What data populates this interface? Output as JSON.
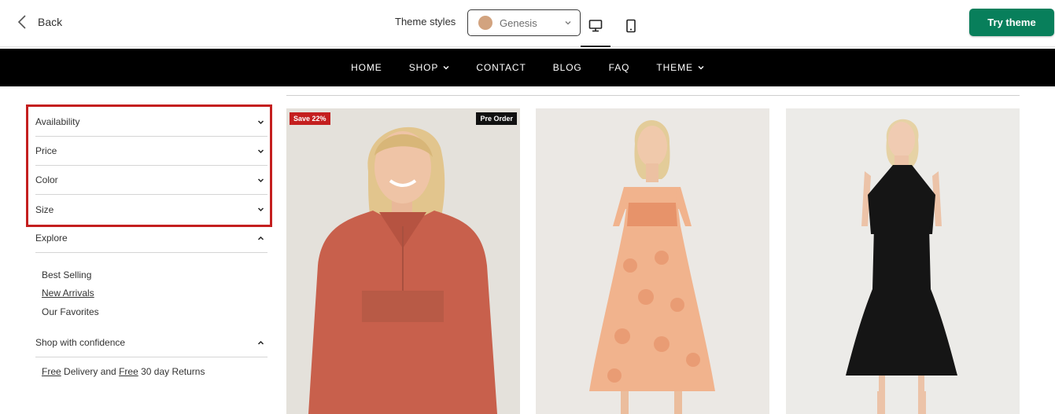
{
  "topbar": {
    "back_label": "Back",
    "theme_styles_label": "Theme styles",
    "theme_select_value": "Genesis",
    "theme_swatch_color": "#d2a37f",
    "try_theme_label": "Try theme",
    "try_theme_color": "#087f5b"
  },
  "nav": {
    "items": [
      {
        "label": "HOME",
        "dropdown": false
      },
      {
        "label": "SHOP",
        "dropdown": true
      },
      {
        "label": "CONTACT",
        "dropdown": false
      },
      {
        "label": "BLOG",
        "dropdown": false
      },
      {
        "label": "FAQ",
        "dropdown": false
      },
      {
        "label": "THEME",
        "dropdown": true
      }
    ]
  },
  "filters": {
    "highlight_color": "#c41f1f",
    "groups": [
      {
        "label": "Availability",
        "icon": "chevron-down-icon"
      },
      {
        "label": "Price",
        "icon": "chevron-down-icon"
      },
      {
        "label": "Color",
        "icon": "chevron-down-icon"
      },
      {
        "label": "Size",
        "icon": "chevron-down-icon"
      }
    ],
    "explore": {
      "label": "Explore",
      "icon": "chevron-up-icon",
      "links": [
        "Best Selling",
        "New Arrivals",
        "Our Favorites"
      ]
    },
    "confidence": {
      "label": "Shop with confidence",
      "icon": "chevron-up-icon",
      "free_1": "Free",
      "text_1": " Delivery and ",
      "free_2": "Free",
      "text_2": " 30 day Returns"
    }
  },
  "products": [
    {
      "sale_badge": "Save 22%",
      "preorder_badge": "Pre Order",
      "dress_color": "#c8604c"
    },
    {
      "dress_color": "#f1b38d"
    },
    {
      "dress_color": "#151515"
    }
  ]
}
